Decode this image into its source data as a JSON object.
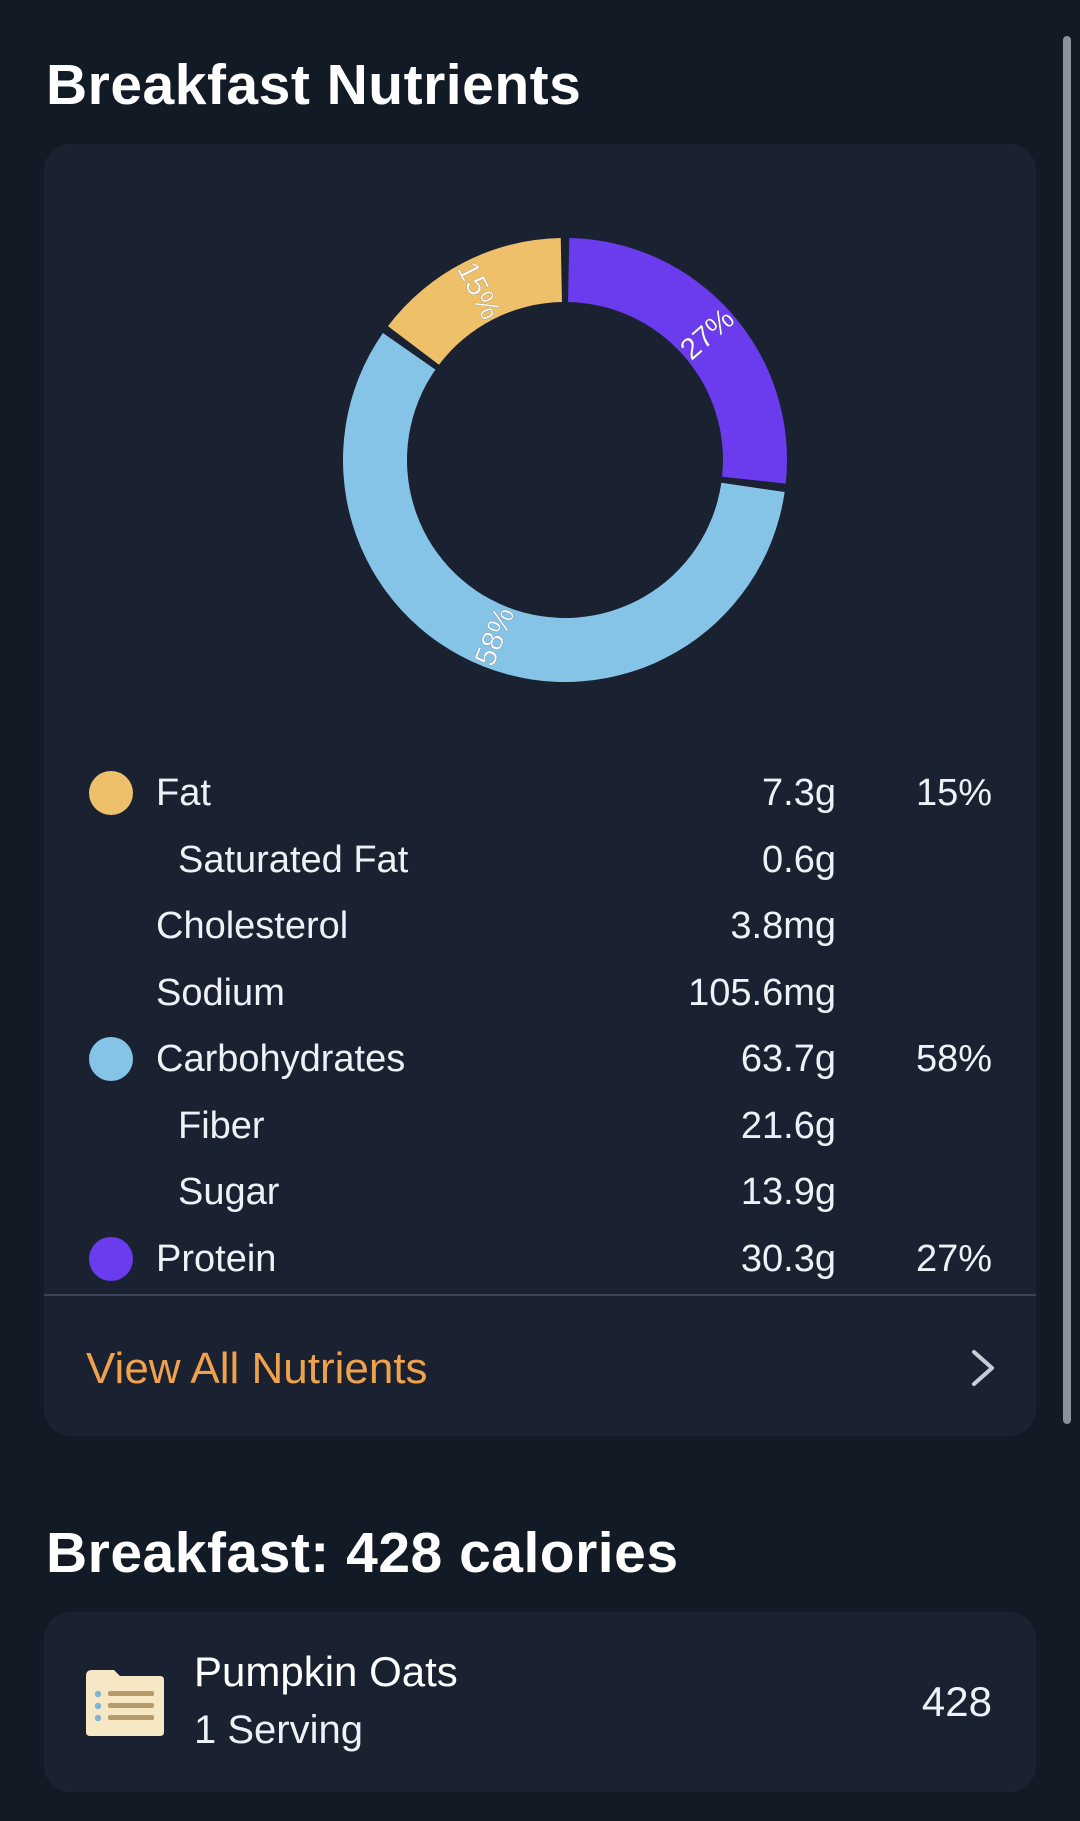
{
  "sections": {
    "nutrients_title": "Breakfast Nutrients",
    "meal_title": "Breakfast: 428 calories"
  },
  "chart_data": {
    "type": "pie",
    "style": "donut",
    "slices": [
      {
        "label": "Protein",
        "percent": 27,
        "percent_label": "27%",
        "color": "#6a3ced"
      },
      {
        "label": "Carbohydrates",
        "percent": 58,
        "percent_label": "58%",
        "color": "#85c4e6"
      },
      {
        "label": "Fat",
        "percent": 15,
        "percent_label": "15%",
        "color": "#eec06a"
      }
    ]
  },
  "nutrients": [
    {
      "name": "Fat",
      "amount": "7.3g",
      "percent": "15%",
      "color": "#eec06a",
      "sub": false
    },
    {
      "name": "Saturated Fat",
      "amount": "0.6g",
      "percent": "",
      "color": "",
      "sub": true
    },
    {
      "name": "Cholesterol",
      "amount": "3.8mg",
      "percent": "",
      "color": "",
      "sub": false
    },
    {
      "name": "Sodium",
      "amount": "105.6mg",
      "percent": "",
      "color": "",
      "sub": false
    },
    {
      "name": "Carbohydrates",
      "amount": "63.7g",
      "percent": "58%",
      "color": "#85c4e6",
      "sub": false
    },
    {
      "name": "Fiber",
      "amount": "21.6g",
      "percent": "",
      "color": "",
      "sub": true
    },
    {
      "name": "Sugar",
      "amount": "13.9g",
      "percent": "",
      "color": "",
      "sub": true
    },
    {
      "name": "Protein",
      "amount": "30.3g",
      "percent": "27%",
      "color": "#6a3ced",
      "sub": false
    }
  ],
  "view_all": {
    "label": "View All Nutrients",
    "icon": "chevron-right-icon"
  },
  "food_items": [
    {
      "name": "Pumpkin Oats",
      "serving": "1 Serving",
      "calories": "428",
      "icon": "recipe-card-icon"
    }
  ],
  "colors": {
    "background": "#121a26",
    "card": "#1a2232",
    "accent": "#f0a24a"
  }
}
